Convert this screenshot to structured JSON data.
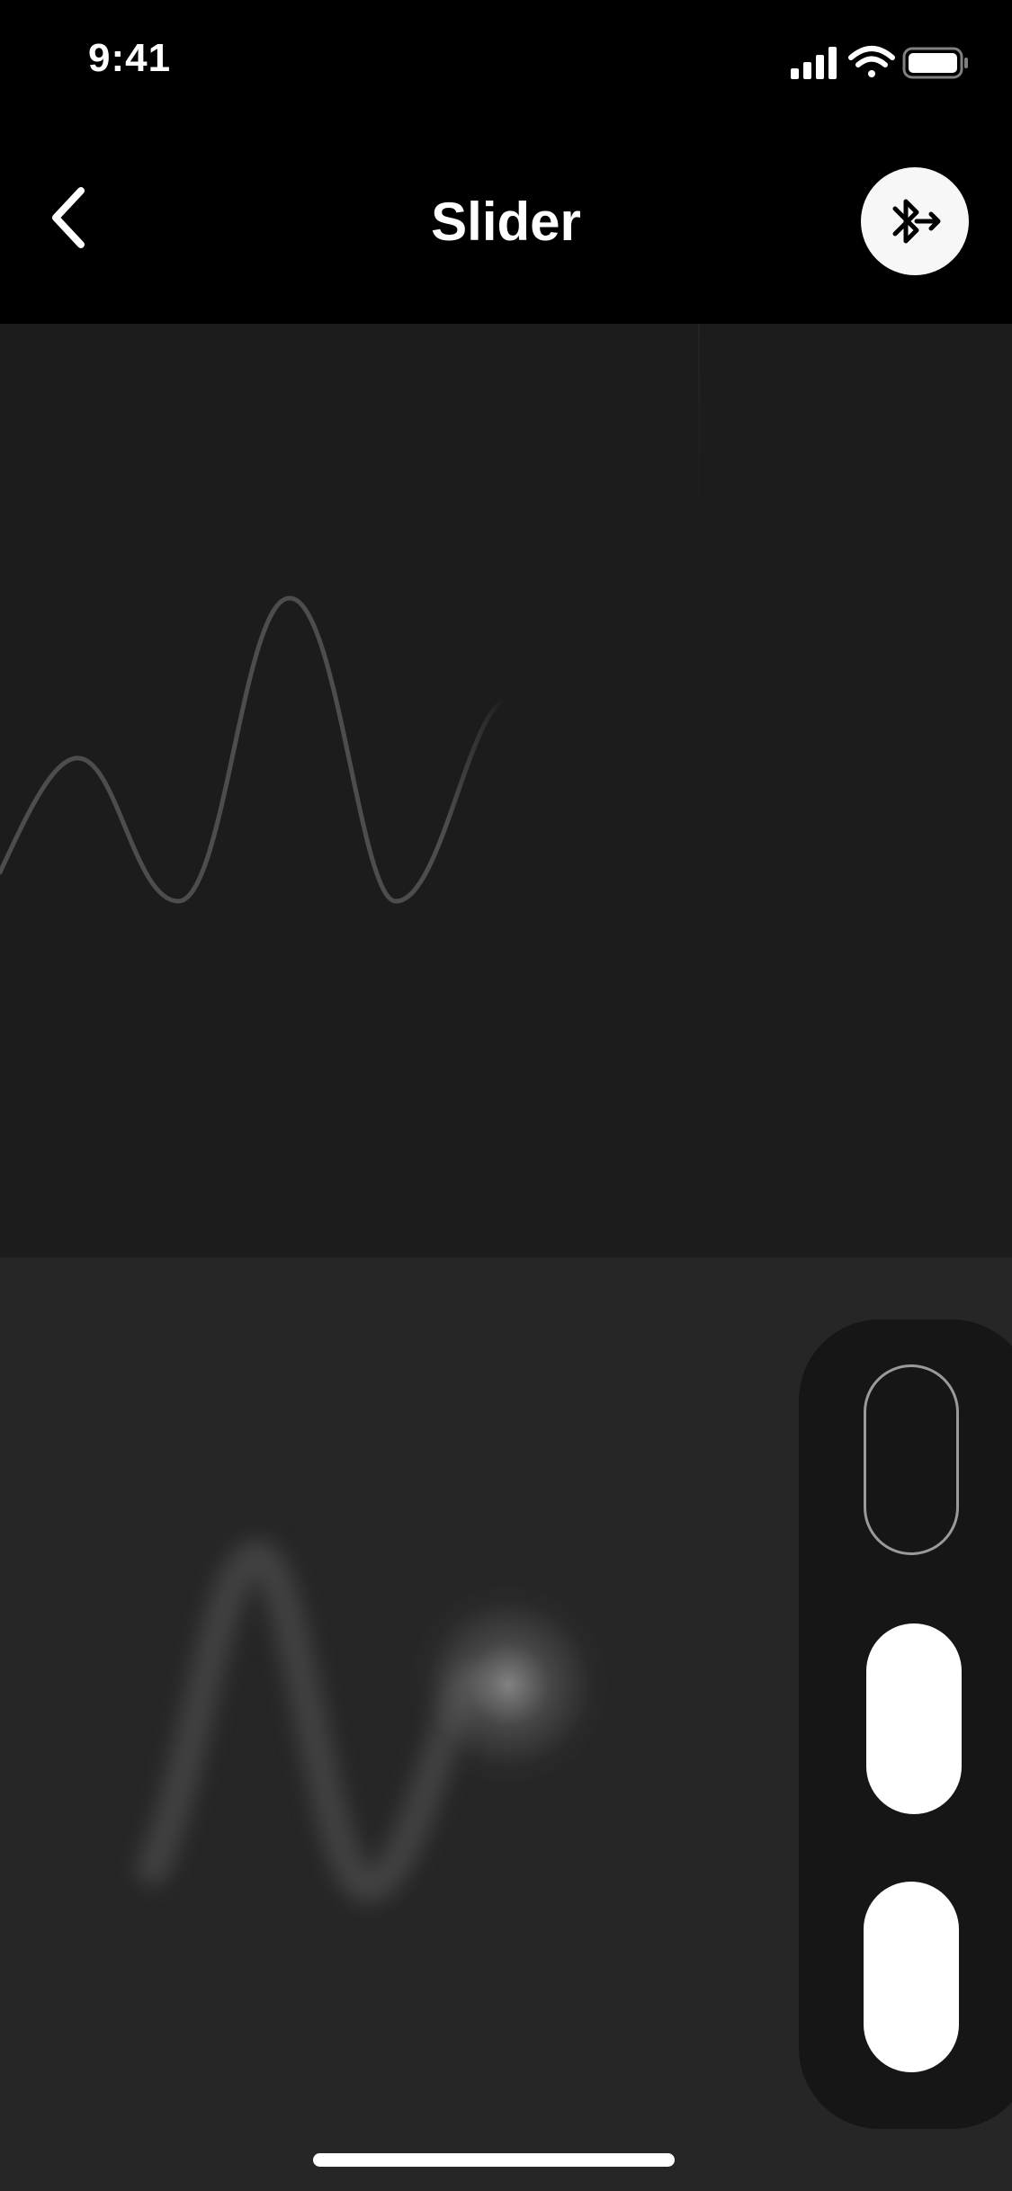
{
  "status_bar": {
    "time": "9:41",
    "icons": [
      "cellular-signal-icon",
      "wifi-icon",
      "battery-icon"
    ]
  },
  "header": {
    "title": "Slider",
    "back_icon": "chevron-left-icon",
    "bluetooth_icon": "bluetooth-connect-icon"
  },
  "colors": {
    "background": "#000000",
    "wave_panel": "#1c1c1c",
    "play_panel": "#262626",
    "selector": "#161616",
    "wave_stroke": "#4a4a4a",
    "accent": "#ffffff"
  },
  "mode_selector": {
    "options": [
      {
        "name": "mode-option-1",
        "state": "unselected"
      },
      {
        "name": "mode-option-2",
        "state": "selected"
      },
      {
        "name": "mode-option-3",
        "state": "selected"
      }
    ]
  }
}
